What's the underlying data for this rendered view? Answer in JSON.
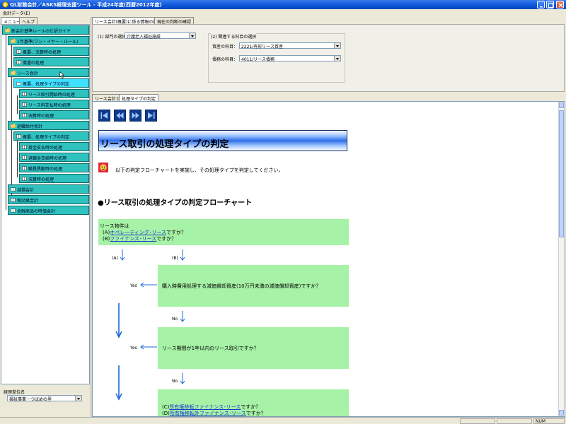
{
  "window": {
    "title": "QL財務会計／ASKS経理支援ツール - 平成24年度(西暦2012年度)"
  },
  "menu": {
    "items": [
      "会計データ(E)"
    ]
  },
  "left_tabs": [
    "メニュー",
    "ヘルプ"
  ],
  "tree": [
    {
      "label": "新会計基準ルールの仕訳ガイド",
      "level": 0
    },
    {
      "label": "1年基準(ワン・イヤー・ルール)",
      "level": 1
    },
    {
      "label": "概要、決算時の処理",
      "level": 2
    },
    {
      "label": "償還の処理",
      "level": 2
    },
    {
      "label": "リース会計",
      "level": 1
    },
    {
      "label": "概要、処理タイプの判定",
      "level": 2,
      "selected": true
    },
    {
      "label": "リース取引開始時の処理",
      "level": 3
    },
    {
      "label": "リース料支払時の処理",
      "level": 3
    },
    {
      "label": "決算時の処理",
      "level": 3
    },
    {
      "label": "退職給付会計",
      "level": 1
    },
    {
      "label": "概要、処理タイプの判定",
      "level": 2
    },
    {
      "label": "掛金支払時の処理",
      "level": 3
    },
    {
      "label": "退職金支給時の処理",
      "level": 3
    },
    {
      "label": "職員異動時の処理",
      "level": 3
    },
    {
      "label": "決算時の処理",
      "level": 3
    },
    {
      "label": "減損会計",
      "level": 1
    },
    {
      "label": "税効果会計",
      "level": 1
    },
    {
      "label": "金融商品の時価会計",
      "level": 1
    }
  ],
  "dept": {
    "label": "経理単位名",
    "value": "福祉事業－つばめの里"
  },
  "top_tabs": [
    "リース会計(概要)に係る情報の指定",
    "現在の判断の確認"
  ],
  "settings": {
    "dept_label": "(1) 部門の選択",
    "dept_value": "介護老人福祉施設",
    "group_label": "(2) 関連する科目の選択",
    "asset_label": "資産の科目：",
    "asset_value": "2221/有形リース資産",
    "debt_label": "債務の科目：",
    "debt_value": "4011/リース債務"
  },
  "low_tabs": [
    "リース会計とは",
    "処理タイプの判定"
  ],
  "content": {
    "title": "リース取引の処理タイプの判定",
    "note": "以下の判定フローチャートを実施し、その処理タイプを判定してください。",
    "heading": "●リース取引の処理タイプの判定フローチャート",
    "q1_line1": "リース物件は",
    "q1_a_prefix": "(A)",
    "q1_a_link": "オペレーティング･リース",
    "q1_a_suffix": "ですか？",
    "q1_b_prefix": "(B)",
    "q1_b_link": "ファイナンス･リース",
    "q1_b_suffix": "ですか？",
    "label_a": "(A)",
    "label_b": "(B)",
    "q2": "購入時費用処理する減価償却資産(10万円未満の減価償却資産)ですか？",
    "yes1": "Yes",
    "no1": "No",
    "q3": "リース期間が1年以内のリース取引ですか？",
    "yes2": "Yes",
    "no2": "No",
    "q4_c_prefix": "(C)",
    "q4_c_link": "所有権移転ファイナンス･リース",
    "q4_c_suffix": "ですか？",
    "q4_d_prefix": "(D)",
    "q4_d_link": "所有権移転外ファイナンス･リース",
    "q4_d_suffix": "ですか？"
  },
  "status": {
    "num": "NUM"
  },
  "colors": {
    "accent": "#2fc2bf",
    "flow_box": "#a6f2a6",
    "title_bar": "#0a55d8"
  }
}
